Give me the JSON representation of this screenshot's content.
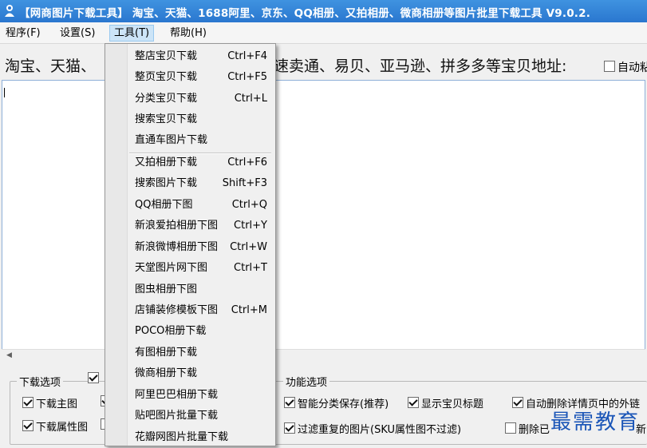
{
  "window": {
    "title": "【网商图片下载工具】 淘宝、天猫、1688阿里、京东、QQ相册、又拍相册、微商相册等图片批里下载工具 V9.0.2."
  },
  "menubar": {
    "items": [
      {
        "label": "程序(F)"
      },
      {
        "label": "设置(S)"
      },
      {
        "label": "工具(T)"
      },
      {
        "label": "帮助(H)"
      }
    ]
  },
  "main": {
    "hint_left": "淘宝、天猫、",
    "hint_right": "速卖通、易贝、亚马逊、拼多多等宝贝地址:",
    "auto_paste_label": "自动粘"
  },
  "tools_menu": {
    "group1": [
      {
        "label": "整店宝贝下载",
        "shortcut": "Ctrl+F4"
      },
      {
        "label": "整页宝贝下载",
        "shortcut": "Ctrl+F5"
      },
      {
        "label": "分类宝贝下载",
        "shortcut": "Ctrl+L"
      },
      {
        "label": "搜索宝贝下载",
        "shortcut": ""
      },
      {
        "label": "直通车图片下载",
        "shortcut": ""
      }
    ],
    "group2": [
      {
        "label": "又拍相册下载",
        "shortcut": "Ctrl+F6"
      },
      {
        "label": "搜索图片下载",
        "shortcut": "Shift+F3"
      },
      {
        "label": "QQ相册下图",
        "shortcut": "Ctrl+Q"
      },
      {
        "label": "新浪爱拍相册下图",
        "shortcut": "Ctrl+Y"
      },
      {
        "label": "新浪微博相册下图",
        "shortcut": "Ctrl+W"
      },
      {
        "label": "天堂图片网下图",
        "shortcut": "Ctrl+T"
      },
      {
        "label": "图虫相册下图",
        "shortcut": ""
      },
      {
        "label": "店铺装修模板下图",
        "shortcut": "Ctrl+M"
      },
      {
        "label": "POCO相册下载",
        "shortcut": ""
      },
      {
        "label": "有图相册下载",
        "shortcut": ""
      },
      {
        "label": "微商相册下载",
        "shortcut": ""
      },
      {
        "label": "阿里巴巴相册下载",
        "shortcut": ""
      },
      {
        "label": "贴吧图片批量下载",
        "shortcut": ""
      },
      {
        "label": "花瓣网图片批量下载",
        "shortcut": ""
      }
    ]
  },
  "download_options": {
    "title": "下载选项",
    "main_image": "下载主图",
    "attr_image": "下载属性图"
  },
  "function_options": {
    "title": "功能选项",
    "smart_save": "智能分类保存(推荐)",
    "show_title": "显示宝贝标题",
    "auto_delete_links": "自动删除详情页中的外链",
    "filter_dup": "过滤重复的图片(SKU属性图不过滤)",
    "delete_prefix": "删除已",
    "new_prefix": "新"
  },
  "watermark": "最需教育",
  "colors": {
    "titlebar": "#2a77cf",
    "menu_highlight": "#cce4f7",
    "watermark": "#1a55b7"
  }
}
